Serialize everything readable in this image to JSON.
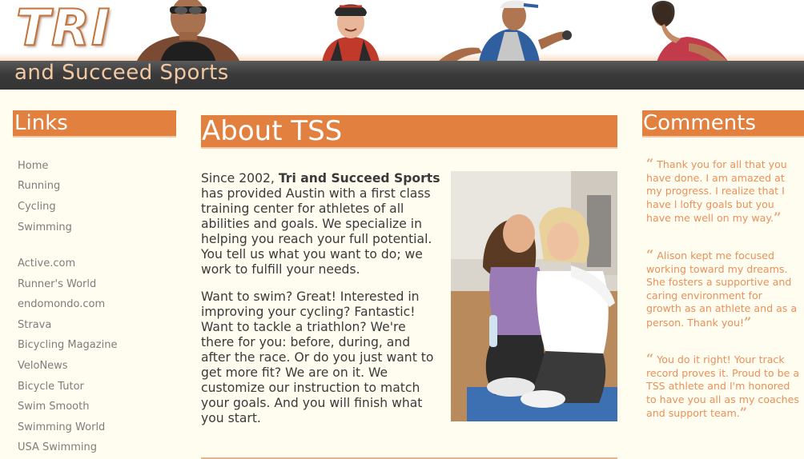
{
  "header": {
    "logo_main": "TRI",
    "logo_sub": "and Succeed Sports"
  },
  "sidebar": {
    "heading": "Links",
    "primary": [
      "Home",
      "Running",
      "Cycling",
      "Swimming"
    ],
    "external": [
      "Active.com",
      "Runner's World",
      "endomondo.com",
      "Strava",
      "Bicycling Magazine",
      "VeloNews",
      "Bicycle Tutor",
      "Swim Smooth",
      "Swimming World",
      "USA Swimming"
    ]
  },
  "main": {
    "heading": "About TSS",
    "p1_intro": "Since 2002, ",
    "p1_brand": "Tri and Succeed Sports",
    "p1_rest": " has provided Austin with a first class training center for athletes of all abilities and goals. We specialize in helping you reach your full potential. You tell us what you want to do; we work to fulfill your needs.",
    "p2": "Want to swim? Great! Interested in improving your cycling? Fantastic! Want to tackle a triathlon? We're there for you: before, during, and after the race. Or do you just want to get more fit? We are on it. We customize our instruction to match your goals. And you will finish what you start."
  },
  "comments": {
    "heading": "Comments",
    "open_quote": "“",
    "close_quote": "”",
    "items": [
      "Thank you for all that you have done. I am amazed at my progress. I realize that I have l lofty goals but you have me well on my way.",
      "Alison kept me focused working toward my dreams. She fosters a supportive and caring environment for growth as an athlete and as a person. Thank you!",
      "You do it right! Your track record proves it. Proud to be a TSS athlete and I'm honored to have you all as my coaches and support team."
    ]
  },
  "colors": {
    "accent": "#e2803f",
    "header_bar": "#3b3b3b",
    "page_bg": "#fffdf0",
    "comment_text": "#e9905a",
    "link_text": "#7d7d7d"
  }
}
